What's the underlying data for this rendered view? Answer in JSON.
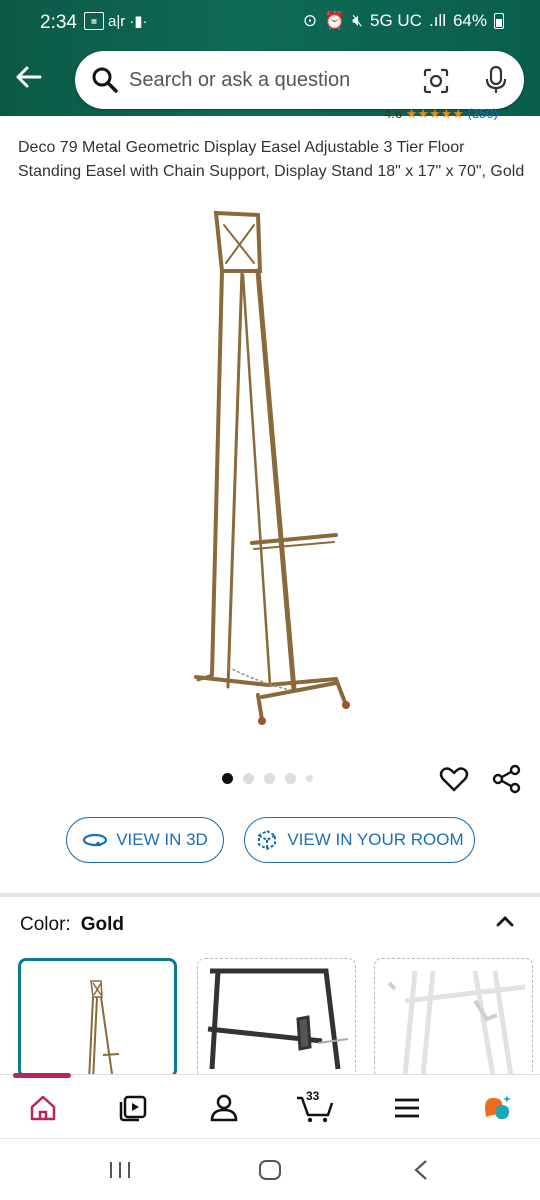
{
  "status_bar": {
    "time": "2:34",
    "network": "5G UC",
    "battery": "64%"
  },
  "search": {
    "placeholder": "Search or ask a question"
  },
  "rating": {
    "value": "4.6",
    "stars": "★★★★★",
    "count": "(350)"
  },
  "product": {
    "title": "Deco 79 Metal Geometric Display Easel Adjustable 3 Tier Floor Standing Easel with Chain Support, Display Stand 18\" x 17\" x 70\", Gold",
    "image_count": 5,
    "active_image": 1
  },
  "actions": {
    "view_3d": "VIEW IN 3D",
    "view_room": "VIEW IN YOUR ROOM"
  },
  "color": {
    "label": "Color:",
    "value": "Gold",
    "swatches": [
      "gold-easel",
      "black-easel",
      "white-easel"
    ]
  },
  "bottom_nav": {
    "items": [
      "home-icon",
      "video-icon",
      "account-icon",
      "cart-icon",
      "menu-icon",
      "rufus-icon"
    ],
    "cart_count": "33"
  },
  "colors": {
    "header": "#0e6a55",
    "accent_blue": "#1b6fb5",
    "swatch_selected": "#0a7c8c",
    "nav_active": "#b9245e",
    "star": "#e28a12"
  }
}
